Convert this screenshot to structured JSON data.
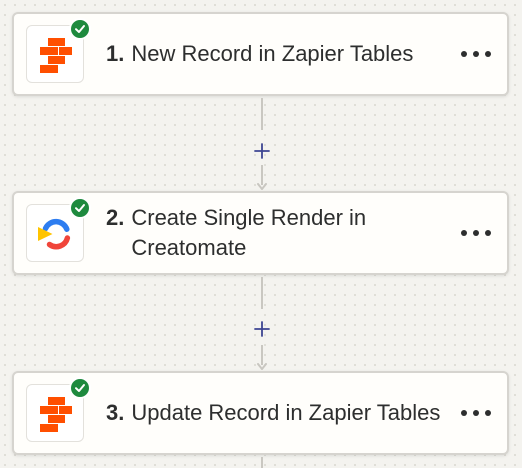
{
  "steps": [
    {
      "number": "1.",
      "title": "New Record in Zapier Tables",
      "app_icon": "zapier-tables-icon",
      "status_icon": "check-circle-icon",
      "menu_icon": "more-horizontal-icon"
    },
    {
      "number": "2.",
      "title": "Create Single Render in Creatomate",
      "app_icon": "creatomate-icon",
      "status_icon": "check-circle-icon",
      "menu_icon": "more-horizontal-icon"
    },
    {
      "number": "3.",
      "title": "Update Record in Zapier Tables",
      "app_icon": "zapier-tables-icon",
      "status_icon": "check-circle-icon",
      "menu_icon": "more-horizontal-icon"
    }
  ],
  "add_step_icon": "plus-icon",
  "colors": {
    "canvas_bg": "#f4f3ef",
    "card_bg": "#fffefb",
    "card_border": "#d6d4cf",
    "success_green": "#1e8a3e",
    "zapier_orange": "#ff4f00",
    "plus_blue": "#3d4592",
    "text": "#2d2e2e"
  }
}
